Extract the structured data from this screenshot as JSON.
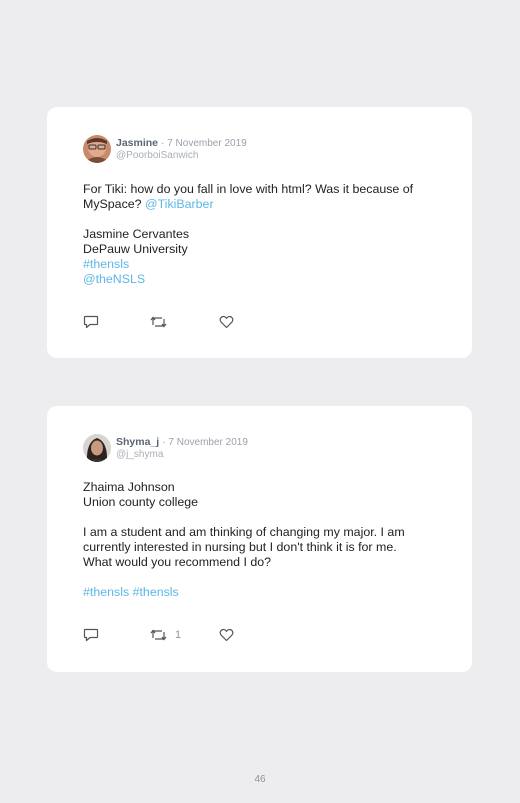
{
  "posts": [
    {
      "name": "Jasmine",
      "separator": "·",
      "date": "7 November 2019",
      "handle": "@PoorboiSanwich",
      "line1": "For Tiki: how do you fall in love with html? Was it because of",
      "line2_text": "MySpace?",
      "line2_mention": "@TikiBarber",
      "line3": "Jasmine Cervantes",
      "line4": "DePauw University",
      "hashtag": "#thensls",
      "mention": "@theNSLS",
      "avatar_icon": "user-photo",
      "reply_icon": "reply-icon",
      "retweet_icon": "retweet-icon",
      "like_icon": "heart-icon"
    },
    {
      "name": "Shyma_j",
      "separator": "·",
      "date": "7 November 2019",
      "handle": "@j_shyma",
      "line1": "Zhaima Johnson",
      "line2": "Union county college",
      "line3": "I am a student and am thinking of changing my major. I am",
      "line4": "currently interested in nursing but I don't think it is for me.",
      "line5": "What would you recommend I do?",
      "hashtags": "#thensls #thensls",
      "retweet_count": "1",
      "avatar_icon": "user-photo",
      "reply_icon": "reply-icon",
      "retweet_icon": "retweet-icon",
      "like_icon": "heart-icon"
    }
  ],
  "page_number": "46",
  "colors": {
    "background": "#ededf0",
    "card": "#ffffff",
    "link": "#5db7e8",
    "name": "#5b6675",
    "meta": "#9aa1aa"
  }
}
